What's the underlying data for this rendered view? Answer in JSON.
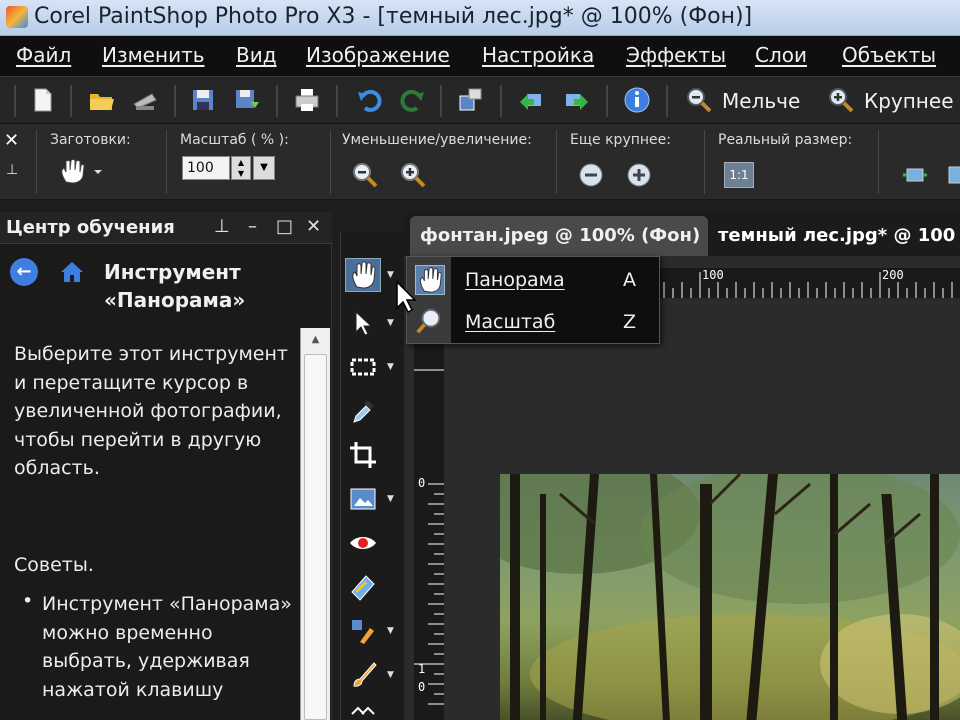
{
  "window": {
    "title": "Corel PaintShop Photo Pro X3 - [темный лес.jpg* @ 100% (Фон)]"
  },
  "menu": [
    "Файл",
    "Изменить",
    "Вид",
    "Изображение",
    "Настройка",
    "Эффекты",
    "Слои",
    "Объекты"
  ],
  "toolbar": {
    "zoom_out_label": "Мельче",
    "zoom_in_label": "Крупнее"
  },
  "options": {
    "presets_label": "Заготовки:",
    "scale_label": "Масштаб ( % ):",
    "scale_value": "100",
    "zoom_label": "Уменьшение/увеличение:",
    "more_label": "Еще крупнее:",
    "actual_label": "Реальный размер:",
    "actual_button": "1:1"
  },
  "learning_center": {
    "title": "Центр обучения",
    "heading": "Инструмент «Панорама»",
    "body": "Выберите этот инструмент и перетащите курсор в увеличенной фотографии, чтобы перейти в другую область.",
    "tips_title": "Советы.",
    "bullet": "•",
    "tip1": "Инструмент «Панорама» можно временно выбрать, удерживая нажатой клавишу"
  },
  "tabs": {
    "tab1": "фонтан.jpeg @ 100% (Фон)",
    "tab2": "темный лес.jpg* @ 100"
  },
  "ruler": {
    "h_100": "100",
    "h_200": "200",
    "v_0": "0",
    "v_1": "1",
    "v_0b": "0"
  },
  "flyout": {
    "items": [
      {
        "label": "Панорама",
        "key": "A",
        "icon": "hand-icon"
      },
      {
        "label": "Масштаб",
        "key": "Z",
        "icon": "magnifier-icon"
      }
    ]
  },
  "colors": {
    "menubar": "#0f0f0f",
    "panel": "#1a1a1a",
    "accent": "#3d7ee0"
  }
}
